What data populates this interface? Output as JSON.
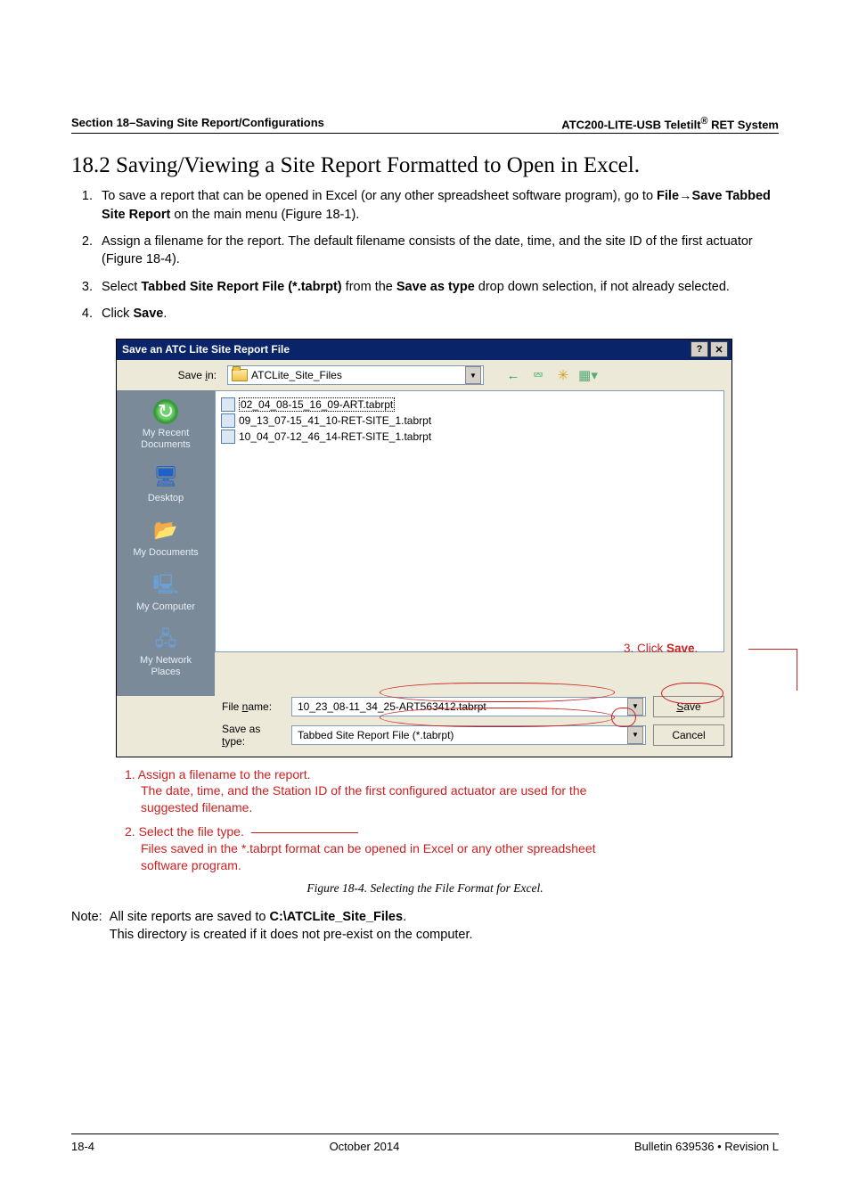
{
  "header": {
    "left": "Section 18–Saving Site Report/Configurations",
    "right_before": "ATC200-LITE-USB Teletilt",
    "right_sup": "®",
    "right_after": " RET System"
  },
  "title": "18.2 Saving/Viewing a Site Report Formatted to Open in Excel.",
  "steps": {
    "s1_a": "To save a report that can be opened in Excel (or any other spreadsheet software program), go to ",
    "s1_b": "File",
    "s1_arrow": "→",
    "s1_c": "Save Tabbed Site Report",
    "s1_d": " on the main menu (Figure 18-1).",
    "s2": "Assign a filename for the report. The default filename consists of the date, time, and the site ID of the first actuator (Figure 18-4).",
    "s3_a": "Select ",
    "s3_b": "Tabbed Site Report File (*.tabrpt)",
    "s3_c": " from the ",
    "s3_d": "Save as type",
    "s3_e": " drop down selection, if not already selected.",
    "s4_a": "Click ",
    "s4_b": "Save",
    "s4_c": "."
  },
  "dialog": {
    "title": "Save an ATC Lite Site Report File",
    "help": "?",
    "close": "✕",
    "save_in_label": "Save in:",
    "save_in_value": "ATCLite_Site_Files",
    "files": [
      "02_04_08-15_16_09-ART.tabrpt",
      "09_13_07-15_41_10-RET-SITE_1.tabrpt",
      "10_04_07-12_46_14-RET-SITE_1.tabrpt"
    ],
    "places": {
      "recent": "My Recent\nDocuments",
      "desktop": "Desktop",
      "mydocs": "My Documents",
      "mycomp": "My Computer",
      "mynet": "My Network\nPlaces"
    },
    "filename_label_pre": "File ",
    "filename_label_u": "n",
    "filename_label_post": "ame:",
    "filename_value": "10_23_08-11_34_25-ART563412.tabrpt",
    "savetype_label_pre": "Save as ",
    "savetype_label_u": "t",
    "savetype_label_post": "ype:",
    "savetype_value": "Tabbed Site Report File (*.tabrpt)",
    "save_btn_u": "S",
    "save_btn_post": "ave",
    "cancel_btn": "Cancel"
  },
  "anno": {
    "click_save": "3. Click Save.",
    "a1_head": "1.  Assign a filename to the report.",
    "a1_body": "The date, time, and the Station ID of the first configured actuator are used for the suggested filename.",
    "a2_head": "2.  Select the file type.",
    "a2_body": "Files saved in the *.tabrpt format can be opened in Excel or any other spreadsheet software program."
  },
  "caption": "Figure 18-4.  Selecting the File Format for Excel.",
  "note": {
    "label": "Note:",
    "line1_a": "All site reports are saved to ",
    "line1_b": "C:\\ATCLite_Site_Files",
    "line1_c": ".",
    "line2": "This directory is created if it does not pre-exist on the computer."
  },
  "footer": {
    "left": "18-4",
    "center": "October 2014",
    "right": "Bulletin 639536  •  Revision L"
  }
}
